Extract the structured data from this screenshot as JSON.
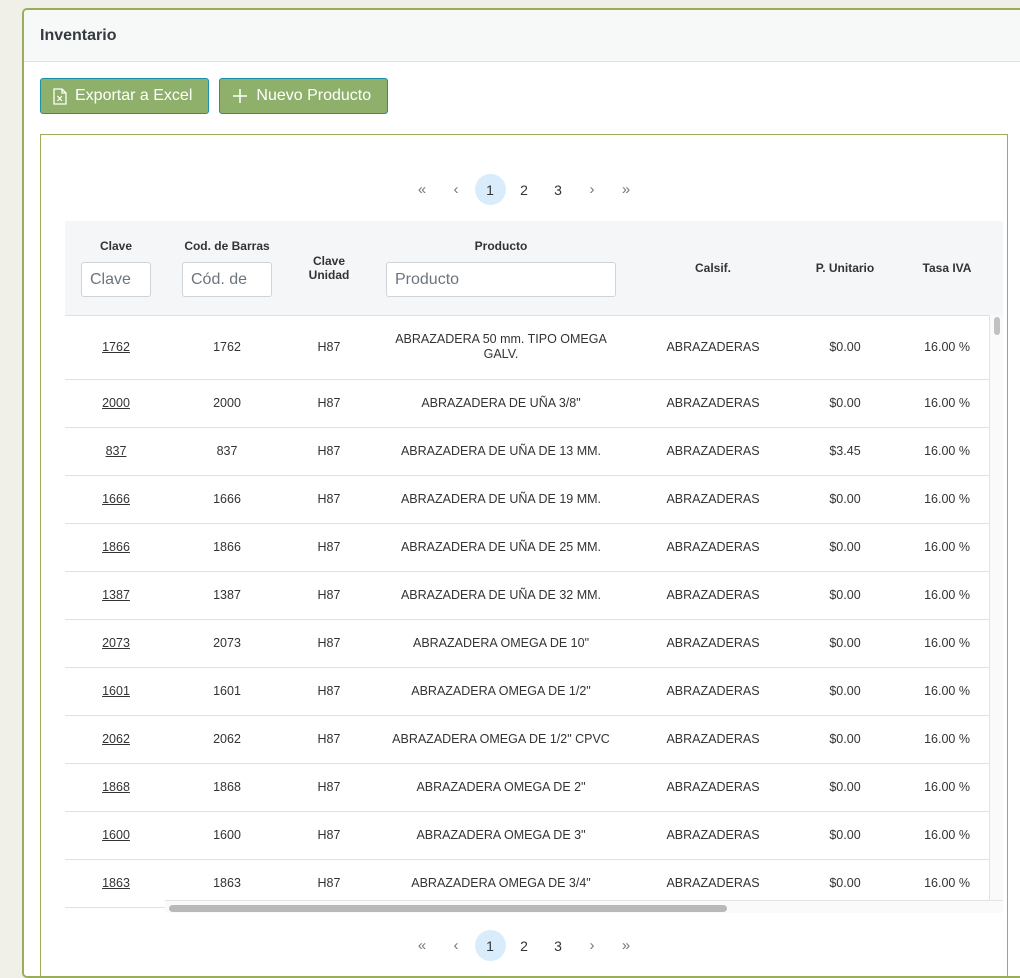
{
  "header": {
    "title": "Inventario"
  },
  "toolbar": {
    "export_label": "Exportar a Excel",
    "export_icon": "excel-file-icon",
    "new_label": "Nuevo Producto",
    "new_icon": "plus-icon"
  },
  "pager_top": {
    "first": "«",
    "prev": "‹",
    "pages": [
      "1",
      "2",
      "3"
    ],
    "active": "1",
    "next": "›",
    "last": "»"
  },
  "pager_bottom": {
    "first": "«",
    "prev": "‹",
    "pages": [
      "1",
      "2",
      "3"
    ],
    "active": "1",
    "next": "›",
    "last": "»"
  },
  "table": {
    "columns": {
      "clave": "Clave",
      "barras": "Cod. de Barras",
      "unidad": "Clave Unidad",
      "producto": "Producto",
      "clasif": "Calsif.",
      "precio": "P. Unitario",
      "iva": "Tasa IVA"
    },
    "filters": {
      "clave_placeholder": "Clave",
      "barras_placeholder": "Cód. de",
      "producto_placeholder": "Producto"
    },
    "rows": [
      {
        "clave": "1762",
        "barras": "1762",
        "unidad": "H87",
        "producto": "ABRAZADERA 50 mm. TIPO OMEGA GALV.",
        "clasif": "ABRAZADERAS",
        "precio": "$0.00",
        "iva": "16.00 %"
      },
      {
        "clave": "2000",
        "barras": "2000",
        "unidad": "H87",
        "producto": "ABRAZADERA DE UÑA 3/8\"",
        "clasif": "ABRAZADERAS",
        "precio": "$0.00",
        "iva": "16.00 %"
      },
      {
        "clave": "837",
        "barras": "837",
        "unidad": "H87",
        "producto": "ABRAZADERA DE UÑA DE 13 MM.",
        "clasif": "ABRAZADERAS",
        "precio": "$3.45",
        "iva": "16.00 %"
      },
      {
        "clave": "1666",
        "barras": "1666",
        "unidad": "H87",
        "producto": "ABRAZADERA DE UÑA DE 19 MM.",
        "clasif": "ABRAZADERAS",
        "precio": "$0.00",
        "iva": "16.00 %"
      },
      {
        "clave": "1866",
        "barras": "1866",
        "unidad": "H87",
        "producto": "ABRAZADERA DE UÑA DE 25 MM.",
        "clasif": "ABRAZADERAS",
        "precio": "$0.00",
        "iva": "16.00 %"
      },
      {
        "clave": "1387",
        "barras": "1387",
        "unidad": "H87",
        "producto": "ABRAZADERA DE UÑA DE 32 MM.",
        "clasif": "ABRAZADERAS",
        "precio": "$0.00",
        "iva": "16.00 %"
      },
      {
        "clave": "2073",
        "barras": "2073",
        "unidad": "H87",
        "producto": "ABRAZADERA OMEGA DE 10\"",
        "clasif": "ABRAZADERAS",
        "precio": "$0.00",
        "iva": "16.00 %"
      },
      {
        "clave": "1601",
        "barras": "1601",
        "unidad": "H87",
        "producto": "ABRAZADERA OMEGA DE 1/2\"",
        "clasif": "ABRAZADERAS",
        "precio": "$0.00",
        "iva": "16.00 %"
      },
      {
        "clave": "2062",
        "barras": "2062",
        "unidad": "H87",
        "producto": "ABRAZADERA OMEGA DE 1/2\" CPVC",
        "clasif": "ABRAZADERAS",
        "precio": "$0.00",
        "iva": "16.00 %"
      },
      {
        "clave": "1868",
        "barras": "1868",
        "unidad": "H87",
        "producto": "ABRAZADERA OMEGA DE 2\"",
        "clasif": "ABRAZADERAS",
        "precio": "$0.00",
        "iva": "16.00 %"
      },
      {
        "clave": "1600",
        "barras": "1600",
        "unidad": "H87",
        "producto": "ABRAZADERA OMEGA DE 3\"",
        "clasif": "ABRAZADERAS",
        "precio": "$0.00",
        "iva": "16.00 %"
      },
      {
        "clave": "1863",
        "barras": "1863",
        "unidad": "H87",
        "producto": "ABRAZADERA OMEGA DE 3/4\"",
        "clasif": "ABRAZADERAS",
        "precio": "$0.00",
        "iva": "16.00 %"
      }
    ]
  }
}
